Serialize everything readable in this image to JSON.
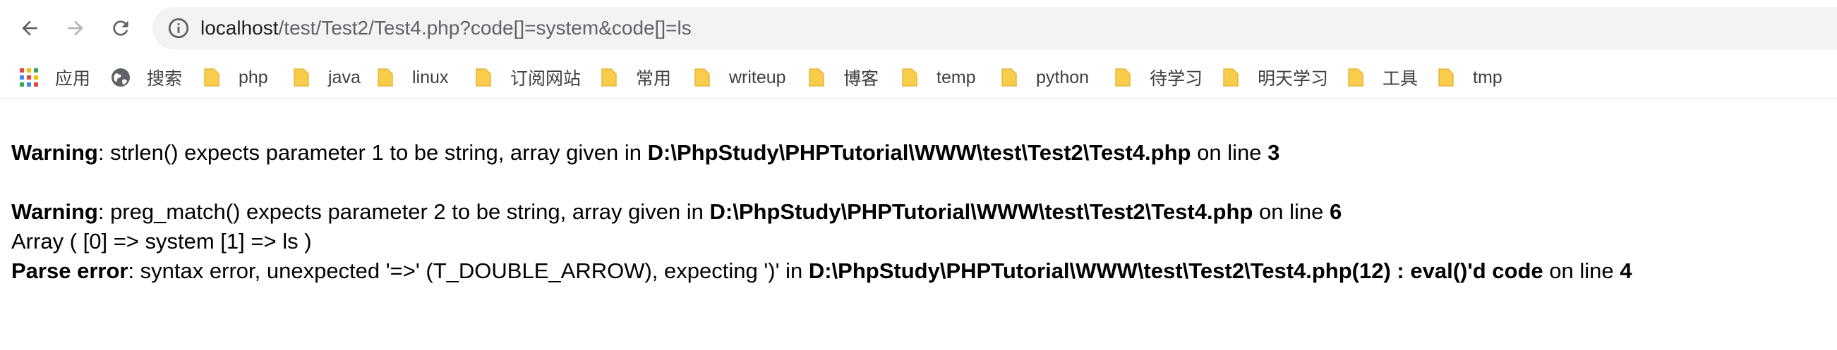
{
  "browser": {
    "url_host": "localhost",
    "url_rest": "/test/Test2/Test4.php?code[]=system&code[]=ls"
  },
  "bookmarks": [
    {
      "label": "应用",
      "icon": "apps-grid-icon"
    },
    {
      "label": "搜索",
      "icon": "globe-icon"
    },
    {
      "label": "php",
      "icon": "folder-icon"
    },
    {
      "label": "java",
      "icon": "folder-icon"
    },
    {
      "label": "linux",
      "icon": "folder-icon"
    },
    {
      "label": "订阅网站",
      "icon": "folder-icon"
    },
    {
      "label": "常用",
      "icon": "folder-icon"
    },
    {
      "label": "writeup",
      "icon": "folder-icon"
    },
    {
      "label": "博客",
      "icon": "folder-icon"
    },
    {
      "label": "temp",
      "icon": "folder-icon"
    },
    {
      "label": "python",
      "icon": "folder-icon"
    },
    {
      "label": "待学习",
      "icon": "folder-icon"
    },
    {
      "label": "明天学习",
      "icon": "folder-icon"
    },
    {
      "label": "工具",
      "icon": "folder-icon"
    },
    {
      "label": "tmp",
      "icon": "folder-icon"
    }
  ],
  "output": {
    "warning1": {
      "label": "Warning",
      "message": ": strlen() expects parameter 1 to be string, array given in ",
      "file": "D:\\PhpStudy\\PHPTutorial\\WWW\\test\\Test2\\Test4.php",
      "on_line": " on line ",
      "line": "3"
    },
    "warning2": {
      "label": "Warning",
      "message": ": preg_match() expects parameter 2 to be string, array given in ",
      "file": "D:\\PhpStudy\\PHPTutorial\\WWW\\test\\Test2\\Test4.php",
      "on_line": " on line ",
      "line": "6"
    },
    "array_dump": "Array ( [0] => system [1] => ls )",
    "parse_error": {
      "label": "Parse error",
      "message": ": syntax error, unexpected '=>' (T_DOUBLE_ARROW), expecting ')' in ",
      "file": "D:\\PhpStudy\\PHPTutorial\\WWW\\test\\Test2\\Test4.php(12) : eval()'d code",
      "on_line": " on line ",
      "line": "4"
    }
  },
  "colors": {
    "folder": "#f9cc4b",
    "folder_dark": "#e8b53a",
    "omnibox_bg": "#f1f3f4",
    "nav_icon": "#5f6368"
  }
}
